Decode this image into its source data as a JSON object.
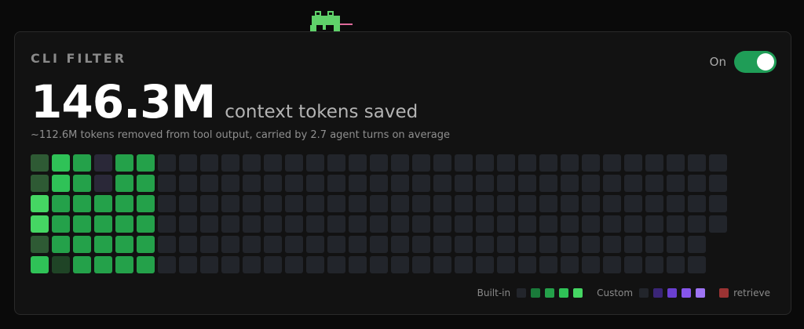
{
  "card": {
    "title": "CLI FILTER",
    "toggle_label": "On",
    "toggle_on": true,
    "big_number": "146.3M",
    "big_caption": "context tokens saved",
    "subtitle": "~112.6M tokens removed from tool output, carried by 2.7 agent turns on average"
  },
  "colors": {
    "accent": "#1f9d57",
    "empty": "#22252b",
    "builtin_levels": [
      "#22252b",
      "#1a7a3a",
      "#24a14a",
      "#2fc257",
      "#45d663"
    ],
    "custom_levels": [
      "#22252b",
      "#3a2577",
      "#6a3fd1",
      "#8655ea",
      "#9e74f4"
    ],
    "retrieve": "#9b3333",
    "dark_green": "#2e5a34",
    "deep_green": "#1f4426",
    "muted_purple": "#2a2838"
  },
  "heatmap": {
    "rows": [
      [
        "dark_green",
        "g3",
        "g2",
        "muted_purple",
        "g2",
        "g2",
        "e",
        "e",
        "e",
        "e",
        "e",
        "e",
        "e",
        "e",
        "e",
        "e",
        "e",
        "e",
        "e",
        "e",
        "e",
        "e",
        "e",
        "e",
        "e",
        "e",
        "e",
        "e",
        "e",
        "e",
        "e",
        "e",
        "e"
      ],
      [
        "dark_green",
        "g3",
        "g2",
        "muted_purple",
        "g2",
        "g2",
        "e",
        "e",
        "e",
        "e",
        "e",
        "e",
        "e",
        "e",
        "e",
        "e",
        "e",
        "e",
        "e",
        "e",
        "e",
        "e",
        "e",
        "e",
        "e",
        "e",
        "e",
        "e",
        "e",
        "e",
        "e",
        "e",
        "e"
      ],
      [
        "g4",
        "g2",
        "g2",
        "g2",
        "g2",
        "g2",
        "e",
        "e",
        "e",
        "e",
        "e",
        "e",
        "e",
        "e",
        "e",
        "e",
        "e",
        "e",
        "e",
        "e",
        "e",
        "e",
        "e",
        "e",
        "e",
        "e",
        "e",
        "e",
        "e",
        "e",
        "e",
        "e",
        "e"
      ],
      [
        "g4",
        "g2",
        "g2",
        "g2",
        "g2",
        "g2",
        "e",
        "e",
        "e",
        "e",
        "e",
        "e",
        "e",
        "e",
        "e",
        "e",
        "e",
        "e",
        "e",
        "e",
        "e",
        "e",
        "e",
        "e",
        "e",
        "e",
        "e",
        "e",
        "e",
        "e",
        "e",
        "e",
        "e"
      ],
      [
        "dark_green",
        "g2",
        "g2",
        "g2",
        "g2",
        "g2",
        "e",
        "e",
        "e",
        "e",
        "e",
        "e",
        "e",
        "e",
        "e",
        "e",
        "e",
        "e",
        "e",
        "e",
        "e",
        "e",
        "e",
        "e",
        "e",
        "e",
        "e",
        "e",
        "e",
        "e",
        "e",
        "e"
      ],
      [
        "g3",
        "deep_green",
        "g2",
        "g2",
        "g2",
        "g2",
        "e",
        "e",
        "e",
        "e",
        "e",
        "e",
        "e",
        "e",
        "e",
        "e",
        "e",
        "e",
        "e",
        "e",
        "e",
        "e",
        "e",
        "e",
        "e",
        "e",
        "e",
        "e",
        "e",
        "e",
        "e",
        "e"
      ]
    ]
  },
  "legend": {
    "builtin_label": "Built-in",
    "custom_label": "Custom",
    "retrieve_label": "retrieve"
  }
}
